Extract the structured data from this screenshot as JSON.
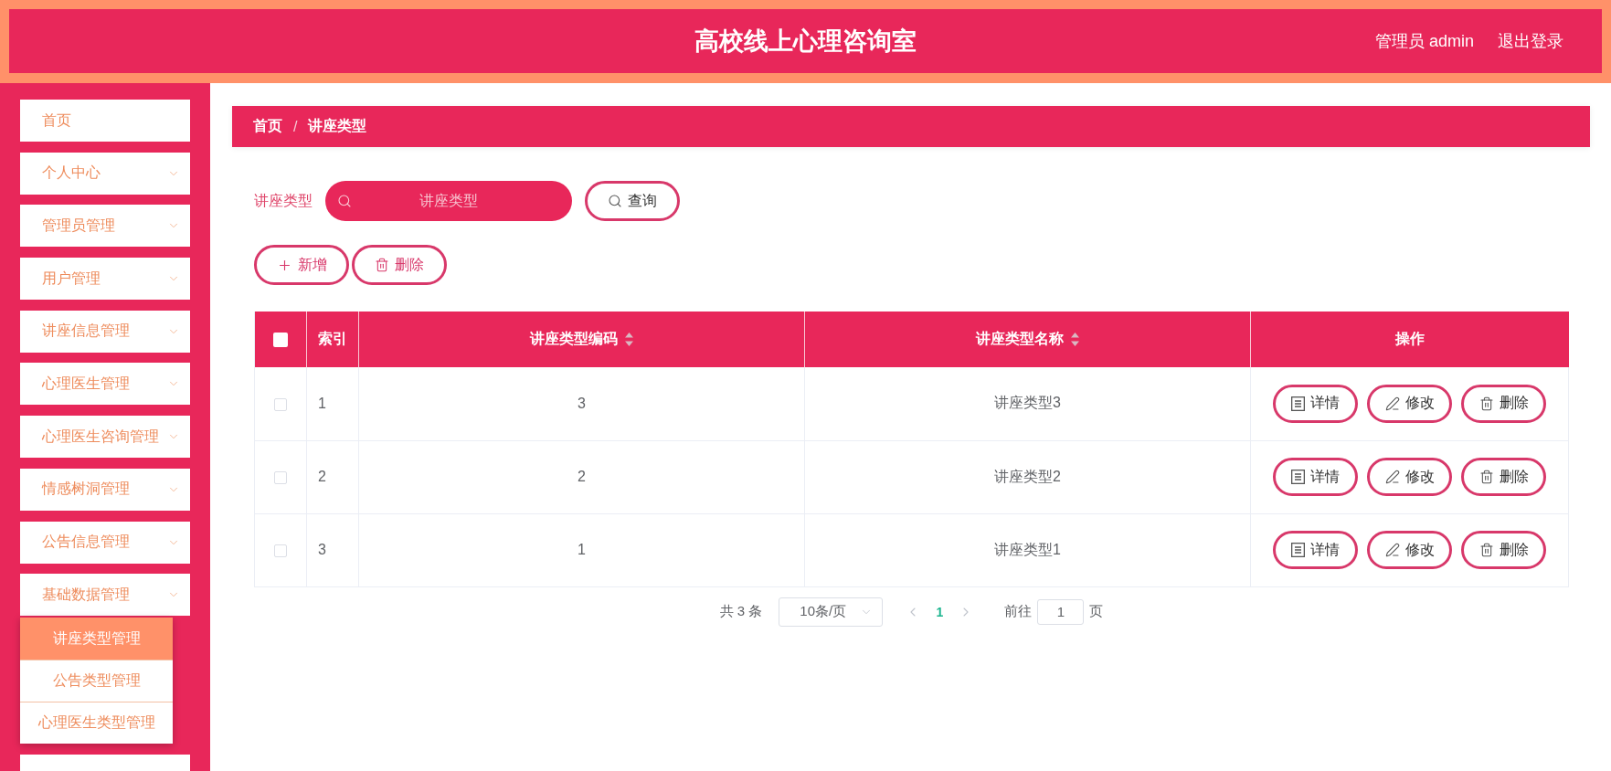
{
  "header": {
    "title": "高校线上心理咨询室",
    "user": "管理员 admin",
    "logout": "退出登录"
  },
  "sidebar": {
    "items": [
      {
        "kind": "link",
        "label": "首页"
      },
      {
        "kind": "menu",
        "label": "个人中心"
      },
      {
        "kind": "menu",
        "label": "管理员管理"
      },
      {
        "kind": "menu",
        "label": "用户管理"
      },
      {
        "kind": "menu",
        "label": "讲座信息管理"
      },
      {
        "kind": "menu",
        "label": "心理医生管理"
      },
      {
        "kind": "menu",
        "label": "心理医生咨询管理"
      },
      {
        "kind": "menu",
        "label": "情感树洞管理"
      },
      {
        "kind": "menu",
        "label": "公告信息管理"
      },
      {
        "kind": "menu",
        "label": "基础数据管理",
        "children": [
          {
            "label": "讲座类型管理",
            "selected": true
          },
          {
            "label": "公告类型管理",
            "selected": false
          },
          {
            "label": "心理医生类型管理",
            "selected": false
          }
        ]
      },
      {
        "kind": "menu"
      }
    ]
  },
  "breadcrumb": {
    "home": "首页",
    "separator": "/",
    "current": "讲座类型"
  },
  "search": {
    "label": "讲座类型",
    "placeholder": "讲座类型",
    "button": "查询"
  },
  "toolbar": [
    {
      "kind": "add",
      "label": "新增"
    },
    {
      "kind": "delete",
      "label": "删除"
    }
  ],
  "table": {
    "header_checkbox": {
      "checked": false
    },
    "columns": [
      {
        "kind": "index",
        "label": "索引",
        "sortable": false
      },
      {
        "kind": "data",
        "label": "讲座类型编码",
        "sortable": true
      },
      {
        "kind": "data",
        "label": "讲座类型名称",
        "sortable": true
      },
      {
        "kind": "actions",
        "label": "操作",
        "sortable": false
      }
    ],
    "rows": [
      {
        "checked": false,
        "cells": [
          "1",
          "3",
          "讲座类型3"
        ],
        "actions": [
          {
            "kind": "detail",
            "label": "详情"
          },
          {
            "kind": "edit",
            "label": "修改"
          },
          {
            "kind": "delete",
            "label": "删除"
          }
        ]
      },
      {
        "checked": false,
        "cells": [
          "2",
          "2",
          "讲座类型2"
        ],
        "actions": [
          {
            "kind": "detail",
            "label": "详情"
          },
          {
            "kind": "edit",
            "label": "修改"
          },
          {
            "kind": "delete",
            "label": "删除"
          }
        ]
      },
      {
        "checked": false,
        "cells": [
          "3",
          "1",
          "讲座类型1"
        ],
        "actions": [
          {
            "kind": "detail",
            "label": "详情"
          },
          {
            "kind": "edit",
            "label": "修改"
          },
          {
            "kind": "delete",
            "label": "删除"
          }
        ]
      }
    ]
  },
  "pagination": {
    "total": "共 3 条",
    "page_size": "10条/页",
    "pages": [
      {
        "label": "1",
        "selected": true
      }
    ],
    "goto_label": "前往",
    "goto_value": "1",
    "goto_suffix": "页"
  }
}
